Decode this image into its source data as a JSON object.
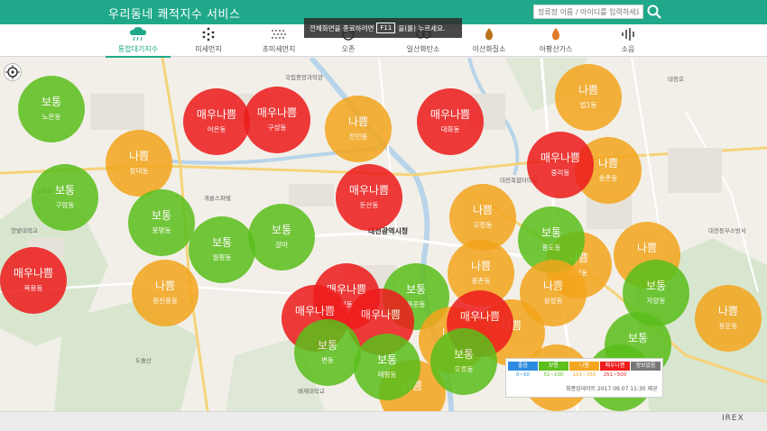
{
  "header": {
    "title": "우리동네 쾌적지수 서비스",
    "search_placeholder": "정류장 이름 / 아이디를 입력하세요."
  },
  "fullscreen_tip": {
    "before": "전체화면을 종료하려면",
    "key": "F11",
    "after": "을(를) 누르세요."
  },
  "tabs": [
    {
      "label": "통합대기지수",
      "icon": "cloud-rain-icon",
      "active": true
    },
    {
      "label": "미세먼지",
      "icon": "particles-icon"
    },
    {
      "label": "초미세먼지",
      "icon": "fine-particles-icon"
    },
    {
      "label": "오존",
      "icon": "ozone-icon"
    },
    {
      "label": "일산화탄소",
      "icon": "co-icon"
    },
    {
      "label": "이산화질소",
      "icon": "no2-icon"
    },
    {
      "label": "아황산가스",
      "icon": "so2-icon"
    },
    {
      "label": "소음",
      "icon": "noise-icon"
    }
  ],
  "map": {
    "city_hall_label": "대전광역시청",
    "bubbles": [
      {
        "grade": "보통",
        "name": "노은동",
        "level": "normal"
      },
      {
        "grade": "매우나쁨",
        "name": "어은동",
        "level": "vbad"
      },
      {
        "grade": "매우나쁨",
        "name": "구성동",
        "level": "vbad"
      },
      {
        "grade": "나쁨",
        "name": "전민동",
        "level": "bad"
      },
      {
        "grade": "매우나쁨",
        "name": "대화동",
        "level": "vbad"
      },
      {
        "grade": "나쁨",
        "name": "법1동",
        "level": "bad"
      },
      {
        "grade": "나쁨",
        "name": "장대동",
        "level": "bad"
      },
      {
        "grade": "매우나쁨",
        "name": "중리동",
        "level": "vbad"
      },
      {
        "grade": "나쁨",
        "name": "송촌동",
        "level": "bad"
      },
      {
        "grade": "보통",
        "name": "구암동",
        "level": "normal"
      },
      {
        "grade": "매우나쁨",
        "name": "둔산동",
        "level": "vbad"
      },
      {
        "grade": "나쁨",
        "name": "오정동",
        "level": "bad"
      },
      {
        "grade": "보통",
        "name": "봉명동",
        "level": "normal"
      },
      {
        "grade": "보통",
        "name": "갈마",
        "level": "normal"
      },
      {
        "grade": "보통",
        "name": "월평동",
        "level": "normal"
      },
      {
        "grade": "보통",
        "name": "홍도동",
        "level": "normal"
      },
      {
        "grade": "나쁨",
        "name": "성남동",
        "level": "bad"
      },
      {
        "grade": "나쁨",
        "name": "",
        "level": "bad"
      },
      {
        "grade": "매우나쁨",
        "name": "복용동",
        "level": "vbad"
      },
      {
        "grade": "나쁨",
        "name": "중촌동",
        "level": "bad"
      },
      {
        "grade": "나쁨",
        "name": "원신흥동",
        "level": "bad"
      },
      {
        "grade": "매우나쁨",
        "name": "정동",
        "level": "vbad"
      },
      {
        "grade": "보통",
        "name": "용운동",
        "level": "normal"
      },
      {
        "grade": "나쁨",
        "name": "삼성동",
        "level": "bad"
      },
      {
        "grade": "보통",
        "name": "자양동",
        "level": "normal"
      },
      {
        "grade": "나쁨",
        "name": "용운동",
        "level": "bad"
      },
      {
        "grade": "매우나쁨",
        "name": "",
        "level": "vbad"
      },
      {
        "grade": "매우나쁨",
        "name": "",
        "level": "vbad"
      },
      {
        "grade": "매우나쁨",
        "name": "",
        "level": "vbad"
      },
      {
        "grade": "보통",
        "name": "변동",
        "level": "normal"
      },
      {
        "grade": "보통",
        "name": "태평동",
        "level": "normal"
      },
      {
        "grade": "보통",
        "name": "오류동",
        "level": "normal"
      },
      {
        "grade": "보통",
        "name": "",
        "level": "normal"
      },
      {
        "grade": "보통",
        "name": "",
        "level": "normal"
      },
      {
        "grade": "나쁨",
        "name": "",
        "level": "bad"
      },
      {
        "grade": "나쁨",
        "name": "",
        "level": "bad"
      },
      {
        "grade": "나쁨",
        "name": "",
        "level": "bad"
      }
    ]
  },
  "legend": {
    "grades": [
      {
        "label": "좋음",
        "range": "0~50",
        "color": "#2c8be0"
      },
      {
        "label": "보통",
        "range": "51~100",
        "color": "#5bbf1c"
      },
      {
        "label": "나쁨",
        "range": "101~250",
        "color": "#f3a51d"
      },
      {
        "label": "매우나쁨",
        "range": "251~500",
        "color": "#ed1c1c"
      },
      {
        "label": "정보없음",
        "range": "",
        "color": "#777777"
      }
    ],
    "update_text": "최종업데이트 2017.09.07 11:30 제공"
  },
  "footer": {
    "brand": "IREX"
  },
  "colors": {
    "brand": "#1fa98a",
    "good": "#5bbf1c",
    "bad": "#f3a51d",
    "very_bad": "#ed1c1c"
  }
}
